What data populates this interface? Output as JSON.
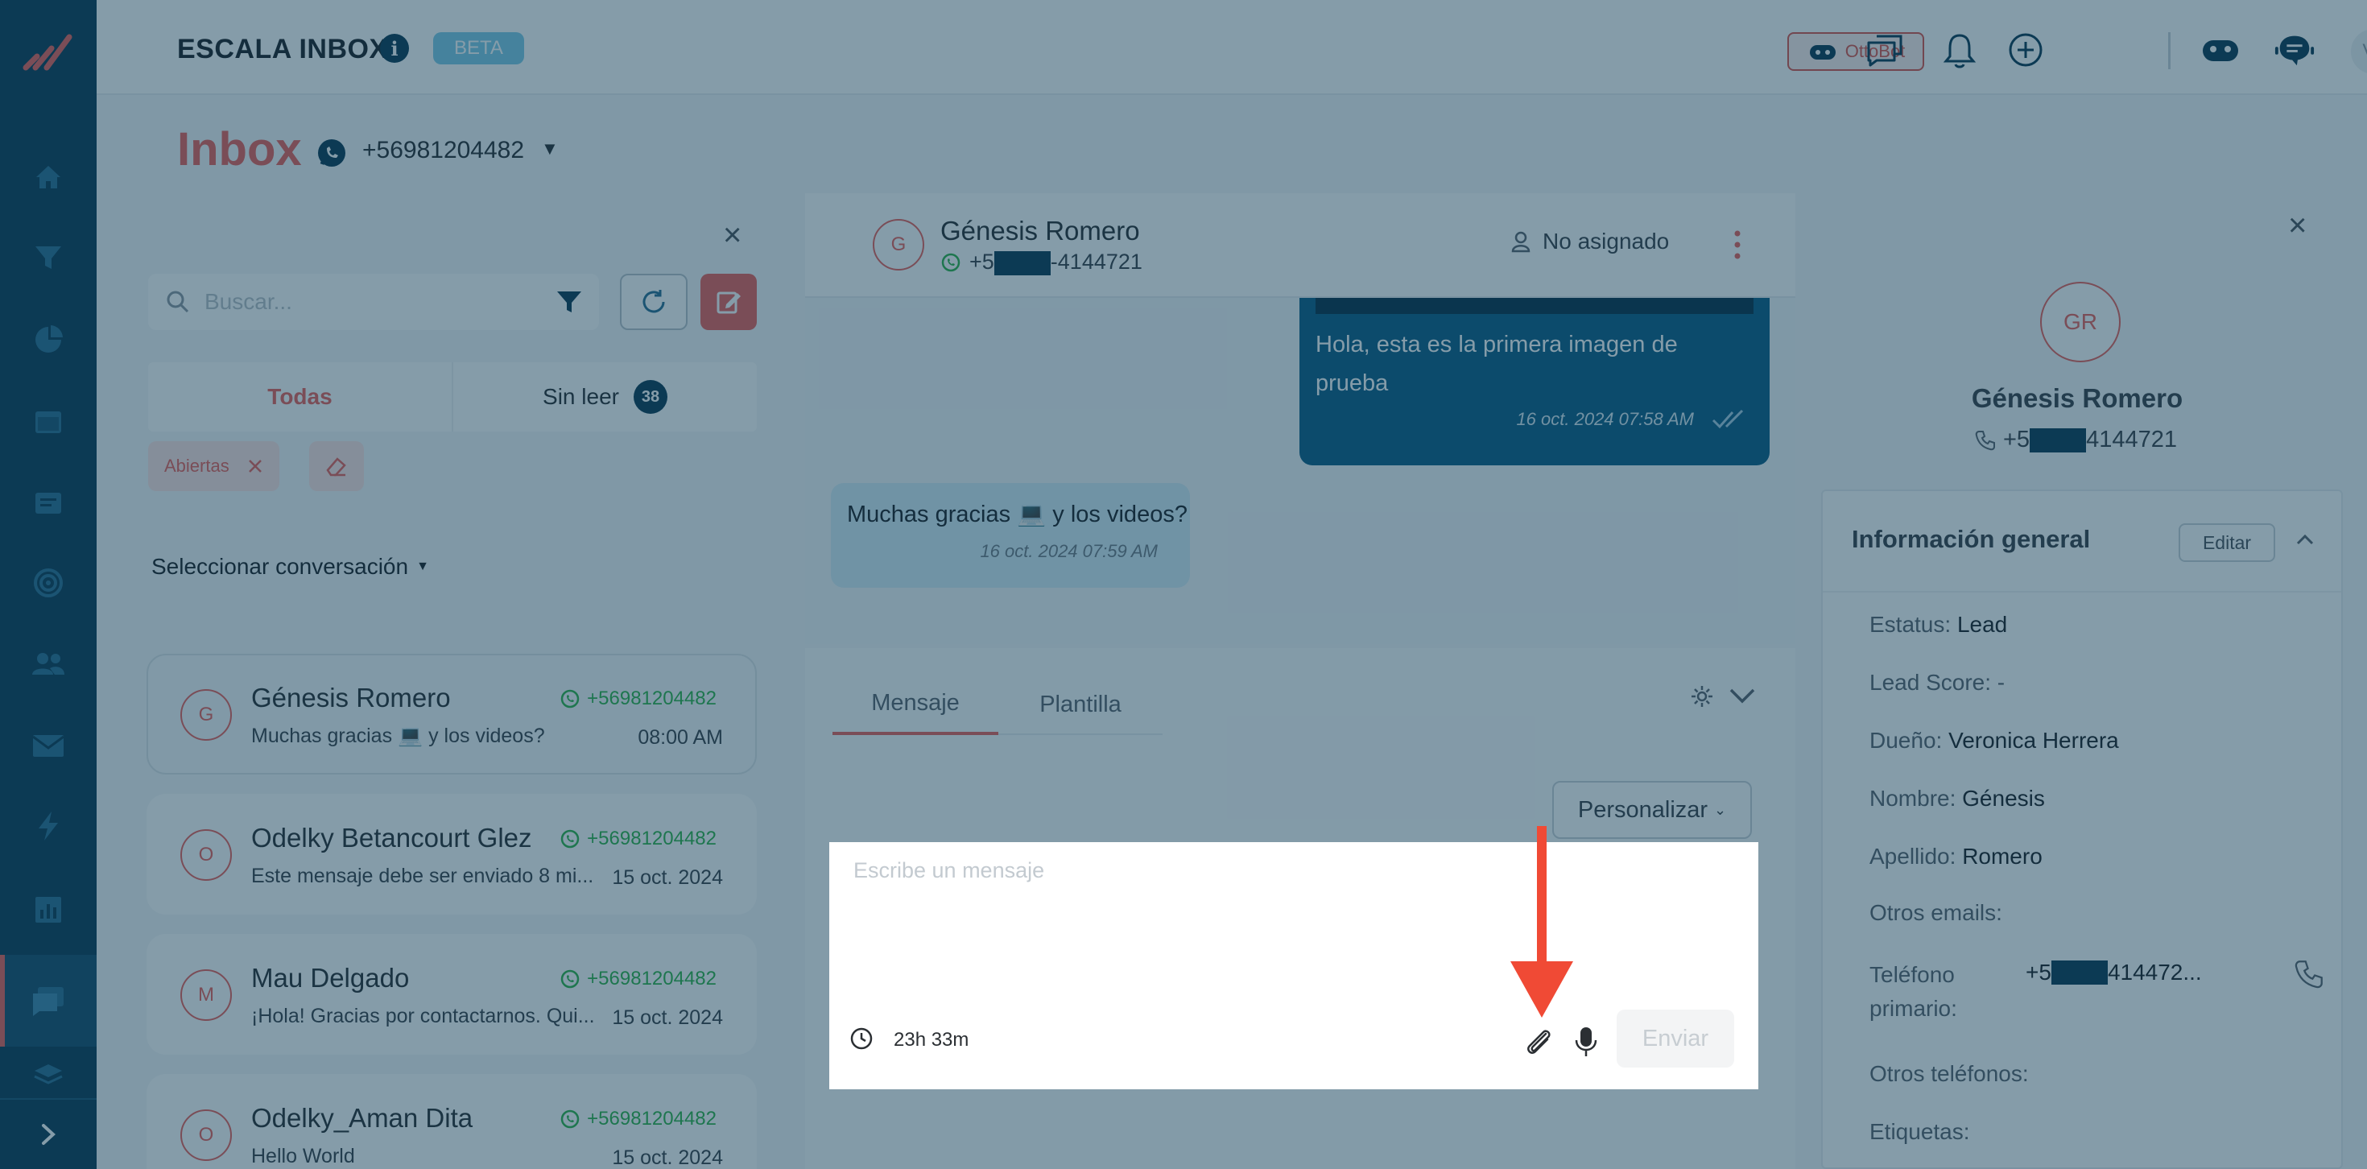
{
  "header": {
    "app_title": "ESCALA INBOX",
    "info_icon": "i",
    "beta_label": "BETA",
    "ottobot_label": "OttoBot",
    "user_initials": "VH"
  },
  "inbox": {
    "title": "Inbox",
    "phone": "+56981204482"
  },
  "list": {
    "search_placeholder": "Buscar...",
    "tab_all": "Todas",
    "tab_unread": "Sin leer",
    "unread_count": "38",
    "filter_chip": "Abiertas",
    "select_label": "Seleccionar conversación",
    "conversations": [
      {
        "initial": "G",
        "name": "Génesis Romero",
        "channel": "+56981204482",
        "preview": "Muchas gracias 💻 y los videos?",
        "time": "08:00 AM"
      },
      {
        "initial": "O",
        "name": "Odelky Betancourt Glez",
        "channel": "+56981204482",
        "preview": "Este mensaje debe ser enviado 8 mi...",
        "time": "15 oct. 2024"
      },
      {
        "initial": "M",
        "name": "Mau Delgado",
        "channel": "+56981204482",
        "preview": "¡Hola! Gracias por contactarnos. Qui...",
        "time": "15 oct. 2024"
      },
      {
        "initial": "O",
        "name": "Odelky_Aman Dita",
        "channel": "+56981204482",
        "preview": "Hello World",
        "time": "15 oct. 2024"
      }
    ]
  },
  "chat": {
    "avatar_initial": "G",
    "name": "Génesis Romero",
    "phone_prefix": "+5",
    "phone_suffix": "-4144721",
    "assigned": "No asignado",
    "outgoing": {
      "text": "Hola, esta es la primera imagen de prueba",
      "time": "16 oct. 2024 07:58 AM"
    },
    "incoming": {
      "text": "Muchas gracias 💻 y los videos?",
      "time": "16 oct. 2024 07:59 AM"
    }
  },
  "composer": {
    "tab_message": "Mensaje",
    "tab_template": "Plantilla",
    "customize_label": "Personalizar",
    "placeholder": "Escribe un mensaje",
    "timer": "23h 33m",
    "send_label": "Enviar"
  },
  "contact": {
    "initials": "GR",
    "name": "Génesis Romero",
    "phone_prefix": "+5",
    "phone_suffix": "4144721",
    "section_title": "Información general",
    "edit_label": "Editar",
    "fields": [
      {
        "label": "Estatus:",
        "value": "Lead"
      },
      {
        "label": "Lead Score:",
        "value": "-"
      },
      {
        "label": "Dueño:",
        "value": "Veronica Herrera"
      },
      {
        "label": "Nombre:",
        "value": "Génesis"
      },
      {
        "label": "Apellido:",
        "value": "Romero"
      },
      {
        "label": "Otros emails:",
        "value": ""
      }
    ],
    "primary_phone_label": "Teléfono primario:",
    "primary_phone_prefix": "+5",
    "primary_phone_suffix": "414472...",
    "other_phones_label": "Otros teléfonos:",
    "tags_label": "Etiquetas:"
  },
  "colors": {
    "brand_navy": "#0d3a55",
    "accent_coral": "#e8615a",
    "whatsapp_green": "#31b34a",
    "overlay": "rgba(12,57,84,0.5)",
    "arrow": "#f04a35"
  }
}
